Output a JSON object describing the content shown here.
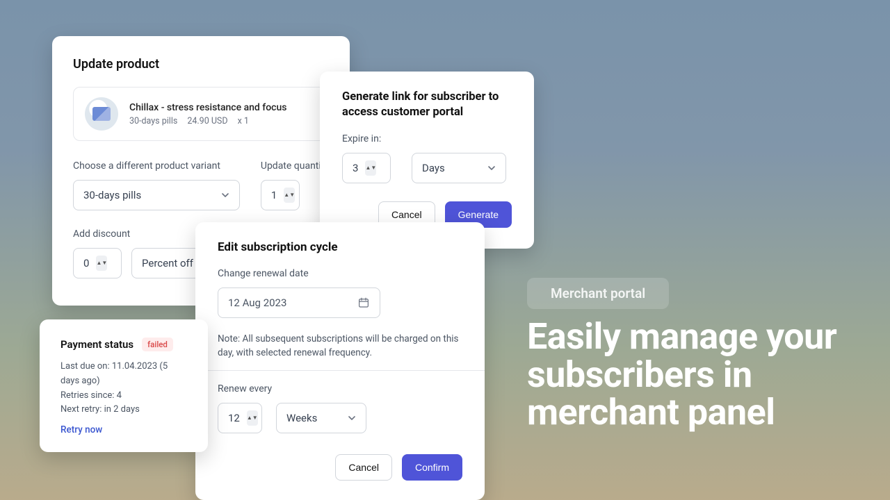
{
  "update_product": {
    "title": "Update product",
    "product_name": "Chillax - stress resistance and focus",
    "variant_text": "30-days pills",
    "price_text": "24.90 USD",
    "qty_text": "x 1",
    "variant_label": "Choose a different product variant",
    "variant_value": "30-days pills",
    "qty_label": "Update quantity",
    "qty_value": "1",
    "discount_label": "Add discount",
    "discount_value": "0",
    "discount_type": "Percent off"
  },
  "generate_link": {
    "title": "Generate link for subscriber to access customer portal",
    "expire_label": "Expire in:",
    "expire_value": "3",
    "expire_unit": "Days",
    "cancel": "Cancel",
    "confirm": "Generate"
  },
  "edit_cycle": {
    "title": "Edit subscription cycle",
    "date_label": "Change renewal date",
    "date_value": "12 Aug 2023",
    "note": "Note: All subsequent subscriptions will be charged on this day, with selected renewal frequency.",
    "renew_label": "Renew every",
    "renew_value": "12",
    "renew_unit": "Weeks",
    "cancel": "Cancel",
    "confirm": "Confirm"
  },
  "payment_status": {
    "title": "Payment status",
    "badge": "failed",
    "last_due": "Last due on: 11.04.2023 (5 days ago)",
    "retries": "Retries since: 4",
    "next_retry": "Next retry: in 2 days",
    "retry_link": "Retry now"
  },
  "marketing": {
    "pill": "Merchant portal",
    "headline": "Easily manage your subscribers in merchant panel"
  }
}
